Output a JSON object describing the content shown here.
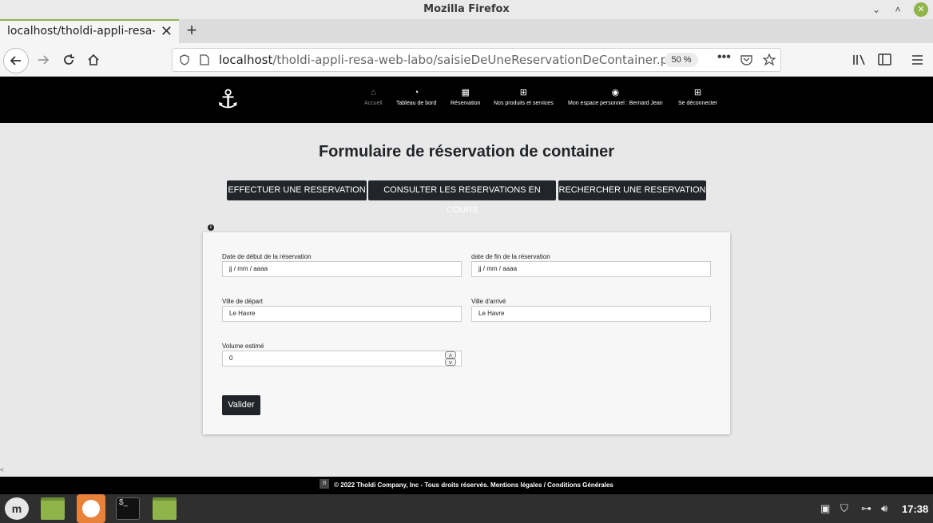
{
  "window": {
    "title": "Mozilla Firefox",
    "minimize": "⌄",
    "maximize": "˄",
    "close": "✕"
  },
  "tab": {
    "label": "localhost/tholdi-appli-resa-web-labo",
    "close": "✕",
    "new_tab": "+"
  },
  "toolbar": {
    "url_host": "localhost",
    "url_path": "/tholdi-appli-resa-web-labo/saisieDeUneReservationDeContainer.php",
    "zoom": "50 %"
  },
  "site_nav": {
    "items": [
      {
        "label": "Accueil",
        "icon": "home-icon"
      },
      {
        "label": "Tableau de bord",
        "icon": "speedometer-icon"
      },
      {
        "label": "Réservation",
        "icon": "table-icon"
      },
      {
        "label": "Nos produits et services",
        "icon": "grid-icon"
      },
      {
        "label": "Mon espace personnel : Bernard Jean",
        "icon": "user-circle-icon"
      },
      {
        "label": "Se déconnecter",
        "icon": "grid-icon"
      }
    ]
  },
  "main": {
    "title": "Formulaire de réservation de container",
    "buttons": [
      "EFFECTUER UNE RESERVATION",
      "CONSULTER LES RESERVATIONS EN COURS",
      "RECHERCHER UNE RESERVATION"
    ]
  },
  "form": {
    "date_debut_label": "Date de début de la réservation",
    "date_debut_value": "jj / mm / aaaa",
    "date_fin_label": "date de fin de la réservation",
    "date_fin_value": "jj / mm / aaaa",
    "ville_depart_label": "Ville de départ",
    "ville_depart_value": "Le Havre",
    "ville_arrivee_label": "Ville d'arrivé",
    "ville_arrivee_value": "Le Havre",
    "volume_label": "Volume estimé",
    "volume_value": "0",
    "submit_label": "Valider"
  },
  "footer": {
    "badge": "B",
    "text": "© 2022 Tholdi Company, Inc - Tous droits réservés. Mentions légales / Conditions Générales"
  },
  "taskbar": {
    "clock": "17:38",
    "menu_glyph": "m",
    "terminal_glyph": "$_"
  },
  "misc": {
    "collapse_glyph": "<",
    "info_glyph": "i"
  }
}
